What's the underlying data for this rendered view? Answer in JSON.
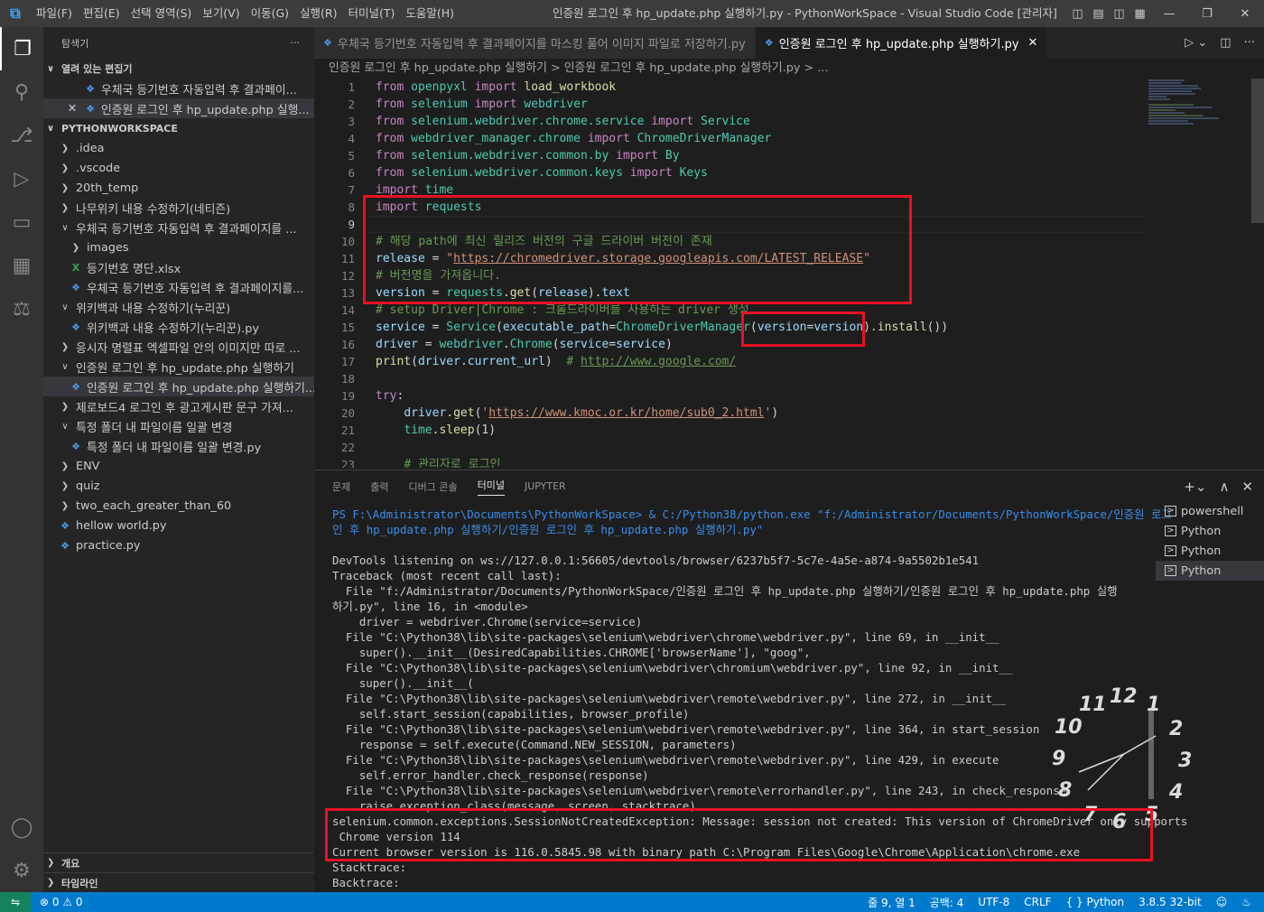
{
  "titlebar": {
    "logo": "X",
    "menu": [
      "파일(F)",
      "편집(E)",
      "선택 영역(S)",
      "보기(V)",
      "이동(G)",
      "실행(R)",
      "터미널(T)",
      "도움말(H)"
    ],
    "title": "인증원 로그인 후 hp_update.php 실행하기.py - PythonWorkSpace - Visual Studio Code [관리자]"
  },
  "sidebar": {
    "header": "탐색기",
    "more": "···",
    "open_editors_label": "열려 있는 편집기",
    "open_editors": [
      {
        "label": "우체국 등기번호 자동입력 후 결과페이..."
      },
      {
        "label": "인증원 로그인 후 hp_update.php 실행..."
      }
    ],
    "workspace_label": "PYTHONWORKSPACE",
    "tree": [
      {
        "label": ".idea",
        "type": "folder",
        "open": false,
        "indent": 1
      },
      {
        "label": ".vscode",
        "type": "folder",
        "open": false,
        "indent": 1
      },
      {
        "label": "20th_temp",
        "type": "folder",
        "open": false,
        "indent": 1
      },
      {
        "label": "나무위키 내용 수정하기(네티즌)",
        "type": "folder",
        "open": false,
        "indent": 1
      },
      {
        "label": "우체국 등기번호 자동입력 후 결과페이지를 ...",
        "type": "folder",
        "open": true,
        "indent": 1
      },
      {
        "label": "images",
        "type": "folder",
        "open": false,
        "indent": 2
      },
      {
        "label": "등기번호 명단.xlsx",
        "type": "xlsx",
        "indent": 2
      },
      {
        "label": "우체국 등기번호 자동입력 후 결과페이지를...",
        "type": "py",
        "indent": 2
      },
      {
        "label": "위키백과 내용 수정하기(누리꾼)",
        "type": "folder",
        "open": true,
        "indent": 1
      },
      {
        "label": "위키백과 내용 수정하기(누리꾼).py",
        "type": "py",
        "indent": 2
      },
      {
        "label": "응시자 명렬표 엑셀파일 안의 이미지만 따로 ...",
        "type": "folder",
        "open": false,
        "indent": 1
      },
      {
        "label": "인증원 로그인 후 hp_update.php 실행하기",
        "type": "folder",
        "open": true,
        "indent": 1
      },
      {
        "label": "인증원 로그인 후 hp_update.php 실행하기....",
        "type": "py",
        "indent": 2,
        "selected": true
      },
      {
        "label": "제로보드4 로그인 후 광고게시판 문구 가져...",
        "type": "folder",
        "open": false,
        "indent": 1
      },
      {
        "label": "특정 폴더 내 파일이름 일괄 변경",
        "type": "folder",
        "open": true,
        "indent": 1
      },
      {
        "label": "특정 폴더 내 파일이름 일괄 변경.py",
        "type": "py",
        "indent": 2
      },
      {
        "label": "ENV",
        "type": "folder",
        "open": false,
        "indent": 1
      },
      {
        "label": "quiz",
        "type": "folder",
        "open": false,
        "indent": 1
      },
      {
        "label": "two_each_greater_than_60",
        "type": "folder",
        "open": false,
        "indent": 1
      },
      {
        "label": "hellow world.py",
        "type": "py",
        "indent": 1
      },
      {
        "label": "practice.py",
        "type": "py",
        "indent": 1
      }
    ],
    "outline_label": "개요",
    "timeline_label": "타임라인"
  },
  "tabs": [
    {
      "label": "우체국 등기번호 자동입력 후 결과페이지를 마스킹 풀어 이미지 파일로 저장하기.py",
      "active": false
    },
    {
      "label": "인증원 로그인 후 hp_update.php 실행하기.py",
      "active": true
    }
  ],
  "breadcrumb": "인증원 로그인 후 hp_update.php 실행하기 > 인증원 로그인 후 hp_update.php 실행하기.py > ...",
  "editor": {
    "current_line": 9,
    "line_numbers": [
      "1",
      "2",
      "3",
      "4",
      "5",
      "6",
      "7",
      "8",
      "9",
      "10",
      "11",
      "12",
      "13",
      "14",
      "15",
      "16",
      "17",
      "18",
      "19",
      "20",
      "21",
      "22",
      "23"
    ]
  },
  "panel": {
    "tabs": [
      "문제",
      "출력",
      "디버그 콘솔",
      "터미널",
      "JUPYTER"
    ],
    "active_tab": "터미널",
    "terminal_lines": [
      "PS F:\\Administrator\\Documents\\PythonWorkSpace> & C:/Python38/python.exe \"f:/Administrator/Documents/PythonWorkSpace/인증원 로그",
      "인 후 hp_update.php 실행하기/인증원 로그인 후 hp_update.php 실행하기.py\"",
      "",
      "DevTools listening on ws://127.0.0.1:56605/devtools/browser/6237b5f7-5c7e-4a5e-a874-9a5502b1e541",
      "Traceback (most recent call last):",
      "  File \"f:/Administrator/Documents/PythonWorkSpace/인증원 로그인 후 hp_update.php 실행하기/인증원 로그인 후 hp_update.php 실행",
      "하기.py\", line 16, in <module>",
      "    driver = webdriver.Chrome(service=service)",
      "  File \"C:\\Python38\\lib\\site-packages\\selenium\\webdriver\\chrome\\webdriver.py\", line 69, in __init__",
      "    super().__init__(DesiredCapabilities.CHROME['browserName'], \"goog\",",
      "  File \"C:\\Python38\\lib\\site-packages\\selenium\\webdriver\\chromium\\webdriver.py\", line 92, in __init__",
      "    super().__init__(",
      "  File \"C:\\Python38\\lib\\site-packages\\selenium\\webdriver\\remote\\webdriver.py\", line 272, in __init__",
      "    self.start_session(capabilities, browser_profile)",
      "  File \"C:\\Python38\\lib\\site-packages\\selenium\\webdriver\\remote\\webdriver.py\", line 364, in start_session",
      "    response = self.execute(Command.NEW_SESSION, parameters)",
      "  File \"C:\\Python38\\lib\\site-packages\\selenium\\webdriver\\remote\\webdriver.py\", line 429, in execute",
      "    self.error_handler.check_response(response)",
      "  File \"C:\\Python38\\lib\\site-packages\\selenium\\webdriver\\remote\\errorhandler.py\", line 243, in check_response",
      "    raise exception_class(message, screen, stacktrace)",
      "selenium.common.exceptions.SessionNotCreatedException: Message: session not created: This version of ChromeDriver only supports",
      " Chrome version 114",
      "Current browser version is 116.0.5845.98 with binary path C:\\Program Files\\Google\\Chrome\\Application\\chrome.exe",
      "Stacktrace:",
      "Backtrace:"
    ],
    "terminals": [
      {
        "label": "powershell",
        "selected": false
      },
      {
        "label": "Python",
        "selected": false
      },
      {
        "label": "Python",
        "selected": false
      },
      {
        "label": "Python",
        "selected": true
      }
    ]
  },
  "clock_numbers": [
    "11",
    "12",
    "1",
    "10",
    "2",
    "9",
    "3",
    "8",
    "4",
    "7",
    "6",
    "5"
  ],
  "statusbar": {
    "errors": "0",
    "warnings": "0",
    "position": "줄 9, 열 1",
    "spaces": "공백: 4",
    "encoding": "UTF-8",
    "eol": "CRLF",
    "language": "Python",
    "interpreter": "3.8.5 32-bit"
  },
  "colors": {
    "accent": "#007acc",
    "highlight": "#e81123"
  }
}
